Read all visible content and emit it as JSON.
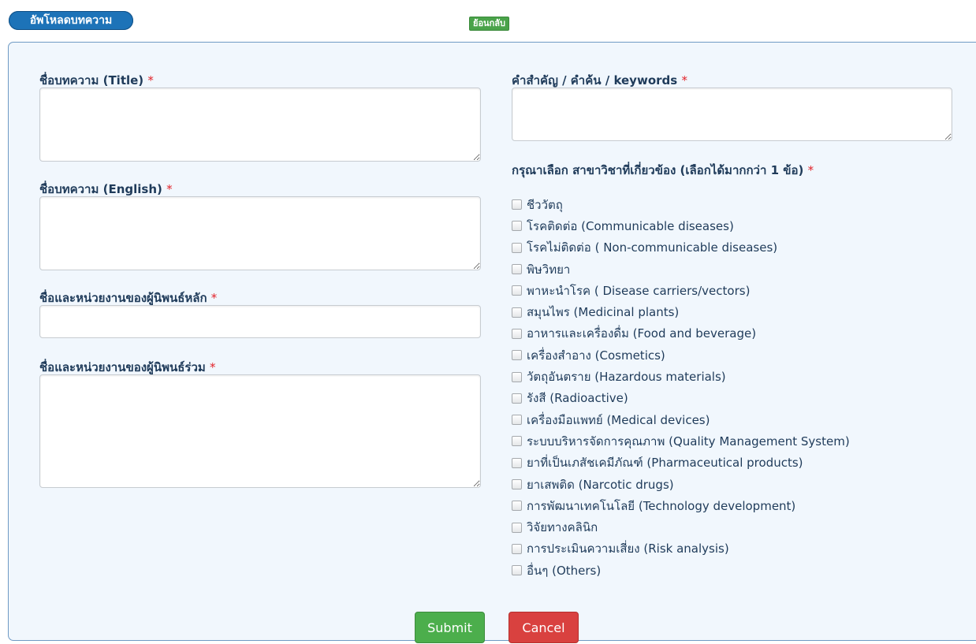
{
  "header": {
    "title": "อัพโหลดบทความ",
    "back_label": "ย้อนกลับ"
  },
  "form": {
    "required_mark": "*",
    "title_label": "ชื่อบทความ (Title)",
    "title_en_label": "ชื่อบทความ (English)",
    "main_author_label": "ชื่อและหน่วยงานของผู้นิพนธ์หลัก",
    "co_author_label": "ชื่อและหน่วยงานของผู้นิพนธ์ร่วม",
    "keywords_label": "คำสำคัญ / คำค้น / keywords",
    "category_label": "กรุณาเลือก สาขาวิชาที่เกี่ยวข้อง (เลือกได้มากกว่า 1 ข้อ)",
    "categories": [
      "ชีววัตถุ",
      "โรคติดต่อ (Communicable diseases)",
      "โรคไม่ติดต่อ ( Non-communicable diseases)",
      "พิษวิทยา",
      "พาหะนำโรค ( Disease carriers/vectors)",
      "สมุนไพร (Medicinal plants)",
      "อาหารและเครื่องดื่ม (Food and beverage)",
      "เครื่องสำอาง (Cosmetics)",
      "วัตถุอันตราย (Hazardous materials)",
      "รังสี (Radioactive)",
      "เครื่องมือแพทย์ (Medical devices)",
      "ระบบบริหารจัดการคุณภาพ (Quality Management System)",
      "ยาที่เป็นเภสัชเคมีภัณฑ์ (Pharmaceutical products)",
      "ยาเสพติด (Narcotic drugs)",
      "การพัฒนาเทคโนโลยี (Technology development)",
      "วิจัยทางคลินิก",
      "การประเมินความเสี่ยง (Risk analysis)",
      "อื่นๆ (Others)"
    ],
    "submit_label": "Submit",
    "cancel_label": "Cancel"
  }
}
